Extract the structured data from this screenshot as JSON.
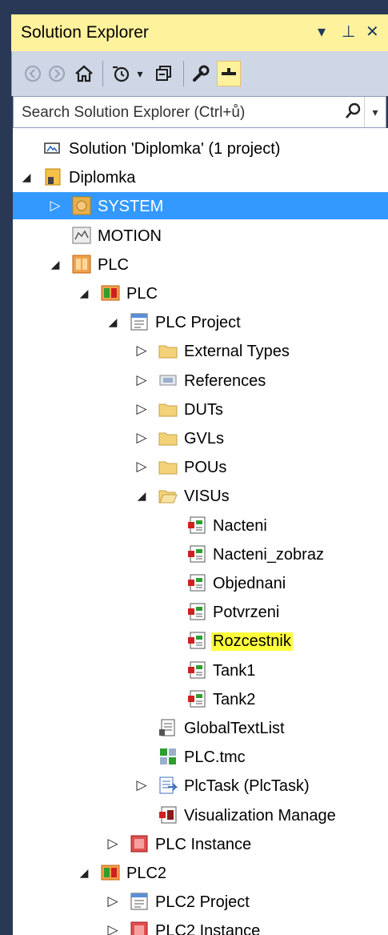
{
  "panel": {
    "title": "Solution Explorer",
    "title_controls": {
      "dropdown": "▾",
      "pin": "⊥",
      "close": "✕"
    }
  },
  "toolbar": {
    "buttons": [
      {
        "name": "back-icon",
        "glyph": "◀"
      },
      {
        "name": "forward-icon",
        "glyph": "▶"
      },
      {
        "name": "home-icon",
        "glyph": "⌂"
      },
      {
        "name": "history-icon",
        "glyph": "⟲"
      },
      {
        "name": "history-dropdown-icon",
        "glyph": "▾"
      },
      {
        "name": "collapse-all-icon",
        "glyph": "⊟"
      },
      {
        "name": "properties-icon",
        "glyph": "✎"
      },
      {
        "name": "preview-icon",
        "glyph": "▬"
      }
    ]
  },
  "search": {
    "placeholder": "Search Solution Explorer (Ctrl+ů)",
    "icon": "search-icon",
    "dropdown": "▾"
  },
  "colors": {
    "title_bg": "#FFF29D",
    "selected_bg": "#3399FF",
    "highlight_bg": "#FFFF3C",
    "panel_bg": "#293955",
    "toolbar_bg": "#CFD6E5"
  },
  "tree": [
    {
      "label": "Solution 'Diplomka' (1 project)",
      "depth": 0,
      "arrow": "none",
      "icon": "solution-icon"
    },
    {
      "label": "Diplomka",
      "depth": 0,
      "arrow": "expanded",
      "icon": "twincat-project-icon"
    },
    {
      "label": "SYSTEM",
      "depth": 1,
      "arrow": "collapsed",
      "icon": "system-gear-icon",
      "selected": true
    },
    {
      "label": "MOTION",
      "depth": 1,
      "arrow": "none",
      "icon": "motion-icon"
    },
    {
      "label": "PLC",
      "depth": 1,
      "arrow": "expanded",
      "icon": "plc-folder-icon"
    },
    {
      "label": "PLC",
      "depth": 2,
      "arrow": "expanded",
      "icon": "plc-module-icon"
    },
    {
      "label": "PLC Project",
      "depth": 3,
      "arrow": "expanded",
      "icon": "plc-project-icon"
    },
    {
      "label": "External Types",
      "depth": 4,
      "arrow": "collapsed",
      "icon": "folder-icon"
    },
    {
      "label": "References",
      "depth": 4,
      "arrow": "collapsed",
      "icon": "references-icon"
    },
    {
      "label": "DUTs",
      "depth": 4,
      "arrow": "collapsed",
      "icon": "folder-icon"
    },
    {
      "label": "GVLs",
      "depth": 4,
      "arrow": "collapsed",
      "icon": "folder-icon"
    },
    {
      "label": "POUs",
      "depth": 4,
      "arrow": "collapsed",
      "icon": "folder-icon"
    },
    {
      "label": "VISUs",
      "depth": 4,
      "arrow": "expanded",
      "icon": "folder-open-icon"
    },
    {
      "label": "Nacteni",
      "depth": 5,
      "arrow": "none",
      "icon": "visualization-icon"
    },
    {
      "label": "Nacteni_zobraz",
      "depth": 5,
      "arrow": "none",
      "icon": "visualization-icon"
    },
    {
      "label": "Objednani",
      "depth": 5,
      "arrow": "none",
      "icon": "visualization-icon"
    },
    {
      "label": "Potvrzeni",
      "depth": 5,
      "arrow": "none",
      "icon": "visualization-icon"
    },
    {
      "label": "Rozcestnik",
      "depth": 5,
      "arrow": "none",
      "icon": "visualization-icon",
      "highlighted": true
    },
    {
      "label": "Tank1",
      "depth": 5,
      "arrow": "none",
      "icon": "visualization-icon"
    },
    {
      "label": "Tank2",
      "depth": 5,
      "arrow": "none",
      "icon": "visualization-icon"
    },
    {
      "label": "GlobalTextList",
      "depth": 4,
      "arrow": "none",
      "icon": "text-list-icon"
    },
    {
      "label": "PLC.tmc",
      "depth": 4,
      "arrow": "none",
      "icon": "tmc-icon"
    },
    {
      "label": "PlcTask (PlcTask)",
      "depth": 4,
      "arrow": "collapsed",
      "icon": "task-icon"
    },
    {
      "label": "Visualization Manage",
      "depth": 4,
      "arrow": "none",
      "icon": "visualization-manager-icon"
    },
    {
      "label": "PLC Instance",
      "depth": 3,
      "arrow": "collapsed",
      "icon": "plc-instance-icon"
    },
    {
      "label": "PLC2",
      "depth": 2,
      "arrow": "expanded",
      "icon": "plc-module-icon"
    },
    {
      "label": "PLC2 Project",
      "depth": 3,
      "arrow": "collapsed",
      "icon": "plc-project-icon"
    },
    {
      "label": "PLC2 Instance",
      "depth": 3,
      "arrow": "collapsed",
      "icon": "plc-instance-icon"
    }
  ]
}
